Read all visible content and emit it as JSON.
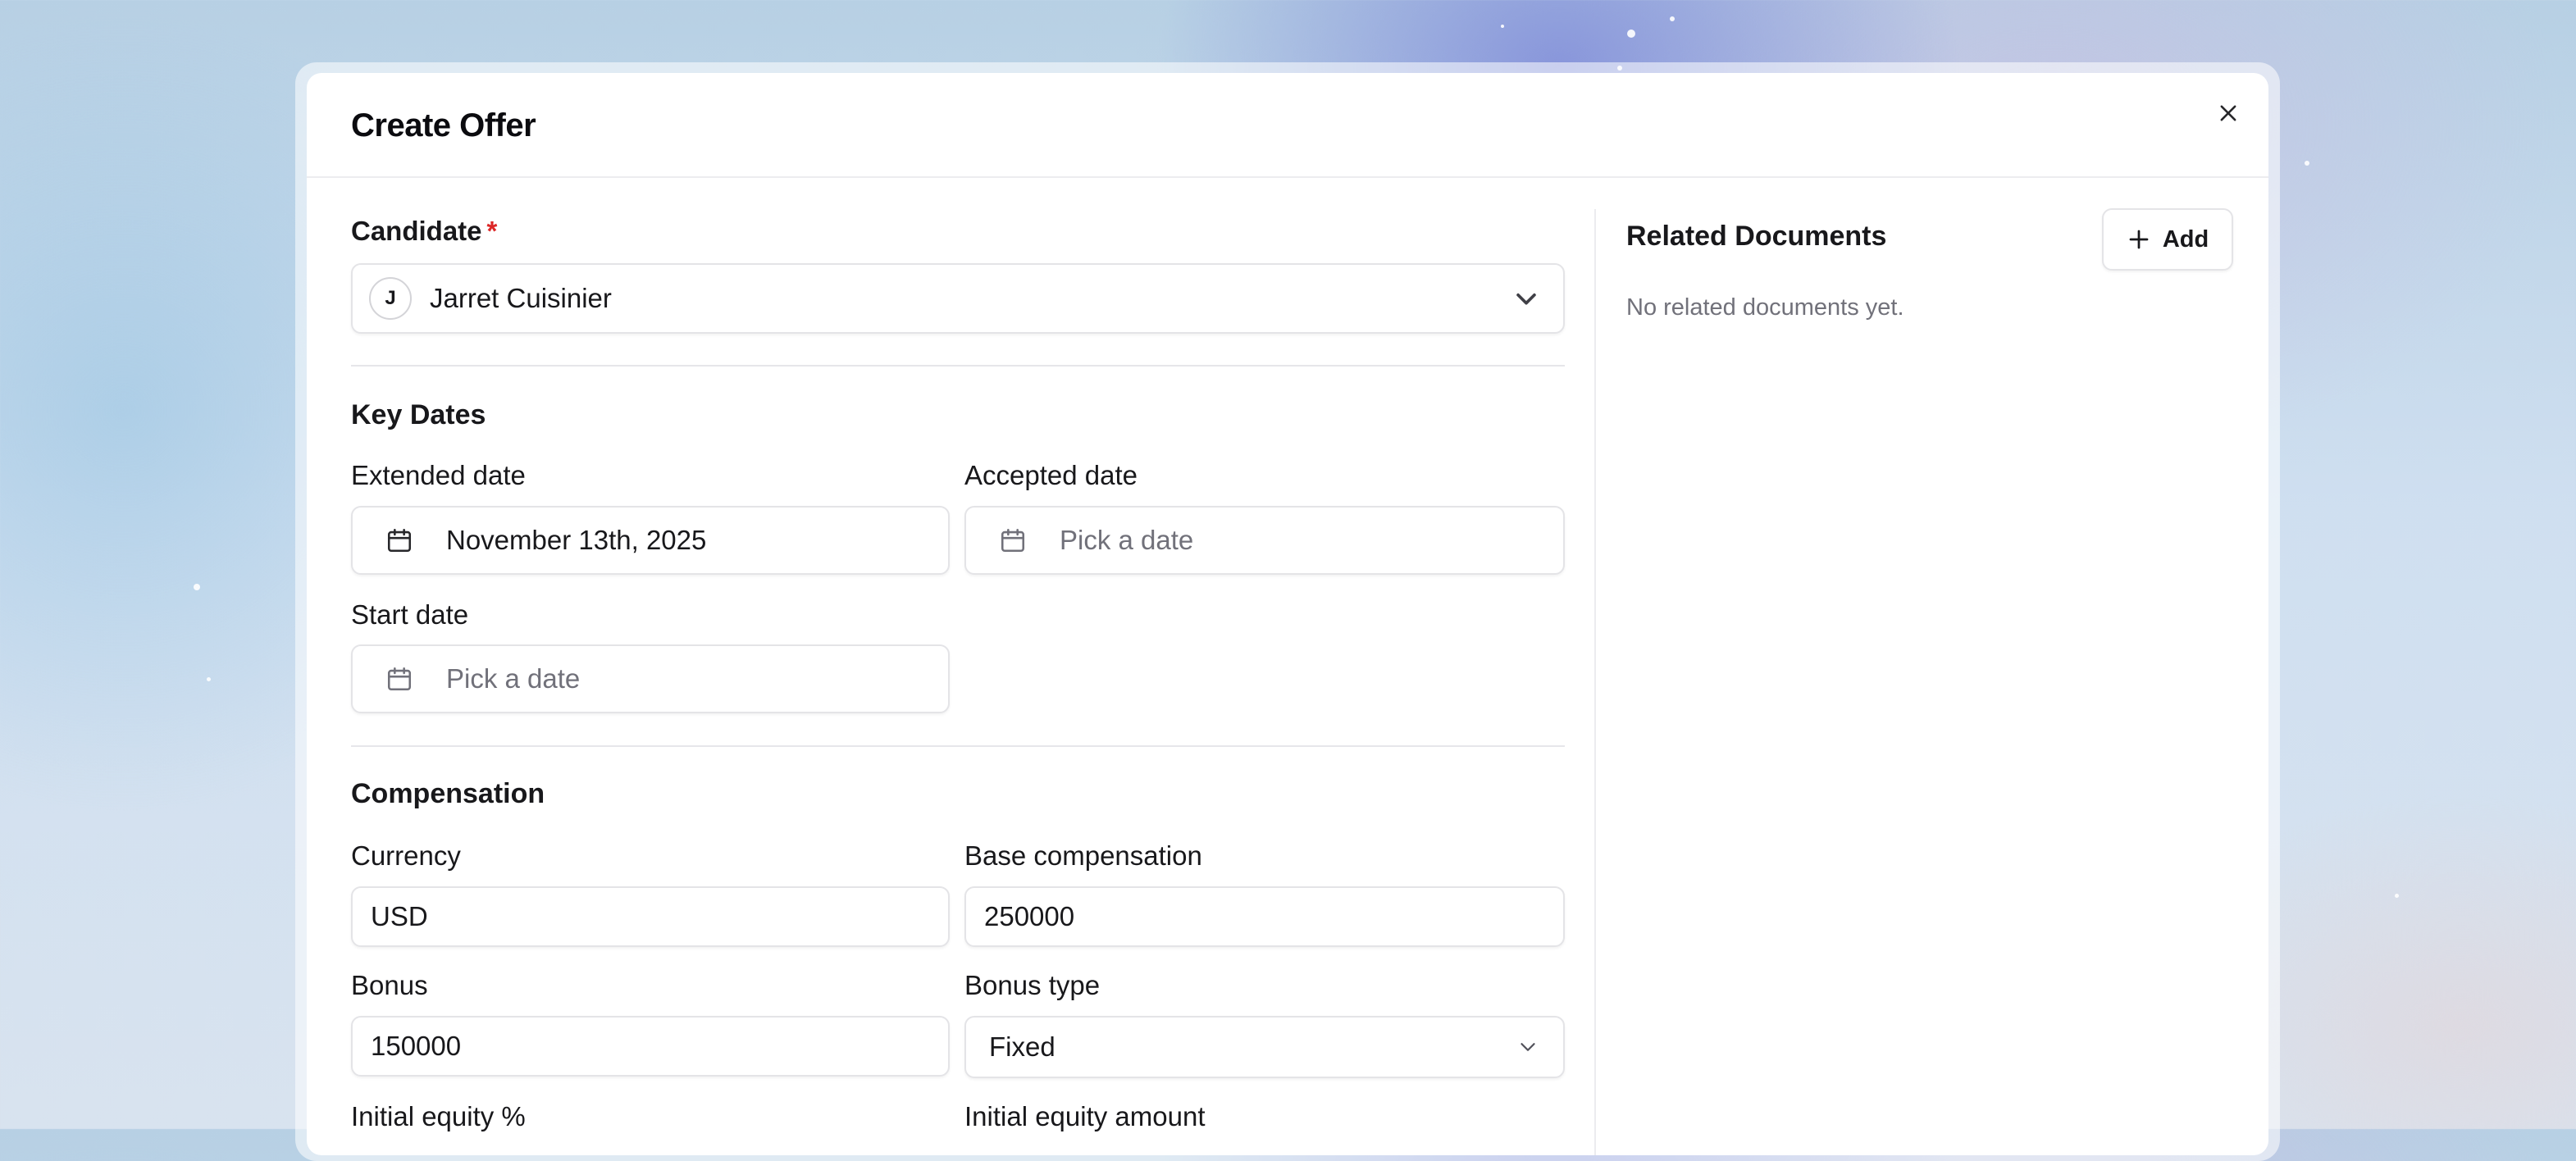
{
  "dialog": {
    "title": "Create Offer"
  },
  "candidate": {
    "label": "Candidate",
    "required_mark": "*",
    "avatar_initial": "J",
    "value": "Jarret Cuisinier"
  },
  "key_dates": {
    "title": "Key Dates",
    "extended": {
      "label": "Extended date",
      "value": "November 13th, 2025"
    },
    "accepted": {
      "label": "Accepted date",
      "placeholder": "Pick a date"
    },
    "start": {
      "label": "Start date",
      "placeholder": "Pick a date"
    }
  },
  "compensation": {
    "title": "Compensation",
    "currency": {
      "label": "Currency",
      "value": "USD"
    },
    "base": {
      "label": "Base compensation",
      "value": "250000"
    },
    "bonus": {
      "label": "Bonus",
      "value": "150000"
    },
    "bonus_type": {
      "label": "Bonus type",
      "value": "Fixed"
    },
    "initial_equity_pct": {
      "label": "Initial equity %"
    },
    "initial_equity_amount": {
      "label": "Initial equity amount"
    }
  },
  "related_documents": {
    "title": "Related Documents",
    "add_label": "Add",
    "empty_text": "No related documents yet."
  },
  "icons": {
    "close": "close-icon",
    "calendar": "calendar-icon",
    "chevron": "chevron-down-icon",
    "plus": "plus-icon"
  }
}
